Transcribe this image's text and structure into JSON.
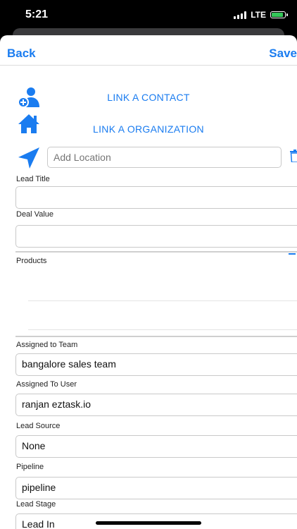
{
  "status": {
    "time": "5:21",
    "network": "LTE"
  },
  "nav": {
    "back": "Back",
    "save": "Save"
  },
  "links": {
    "contact": "LINK A CONTACT",
    "organization": "LINK A ORGANIZATION"
  },
  "location": {
    "placeholder": "Add Location"
  },
  "form": {
    "lead_title_label": "Lead Title",
    "lead_title_value": "",
    "deal_value_label": "Deal Value",
    "deal_value_value": "",
    "products_label": "Products",
    "assigned_team_label": "Assigned to Team",
    "assigned_team_value": "bangalore sales team",
    "assigned_user_label": "Assigned To User",
    "assigned_user_value": "ranjan eztask.io",
    "lead_source_label": "Lead Source",
    "lead_source_value": "None",
    "pipeline_label": "Pipeline",
    "pipeline_value": "pipeline",
    "lead_stage_label": "Lead Stage",
    "lead_stage_value": "Lead In"
  },
  "colors": {
    "accent": "#1a7cf0",
    "battery": "#34c759"
  }
}
